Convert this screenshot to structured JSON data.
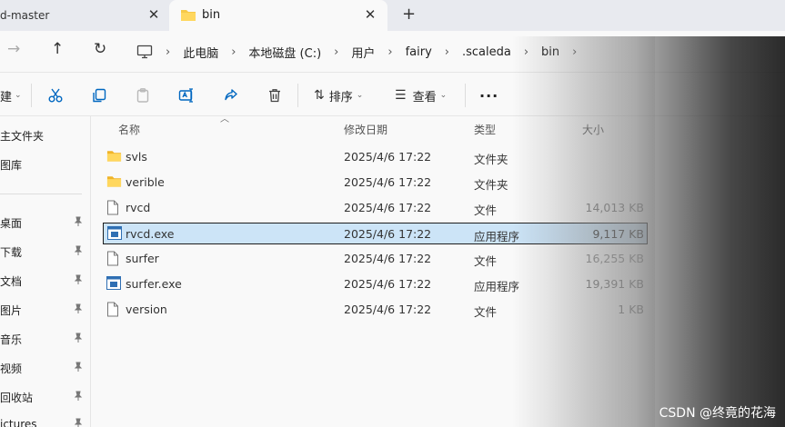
{
  "tabs": {
    "prev_title": "d-master",
    "active_title": "bin"
  },
  "breadcrumb": [
    "此电脑",
    "本地磁盘 (C:)",
    "用户",
    "fairy",
    ".scaleda",
    "bin"
  ],
  "toolbar": {
    "new_label": "建",
    "sort_label": "排序",
    "view_label": "查看"
  },
  "sidebar": {
    "top_items": [
      "主文件夹",
      "图库"
    ],
    "pinned_items": [
      "桌面",
      "下载",
      "文档",
      "图片",
      "音乐",
      "视频",
      "回收站",
      "ictures"
    ]
  },
  "columns": {
    "name": "名称",
    "modified": "修改日期",
    "type": "类型",
    "size": "大小"
  },
  "files": [
    {
      "name": "svls",
      "date": "2025/4/6 17:22",
      "type": "文件夹",
      "size": "",
      "kind": "folder"
    },
    {
      "name": "verible",
      "date": "2025/4/6 17:22",
      "type": "文件夹",
      "size": "",
      "kind": "folder"
    },
    {
      "name": "rvcd",
      "date": "2025/4/6 17:22",
      "type": "文件",
      "size": "14,013 KB",
      "kind": "file"
    },
    {
      "name": "rvcd.exe",
      "date": "2025/4/6 17:22",
      "type": "应用程序",
      "size": "9,117 KB",
      "kind": "exe",
      "selected": true
    },
    {
      "name": "surfer",
      "date": "2025/4/6 17:22",
      "type": "文件",
      "size": "16,255 KB",
      "kind": "file"
    },
    {
      "name": "surfer.exe",
      "date": "2025/4/6 17:22",
      "type": "应用程序",
      "size": "19,391 KB",
      "kind": "exe"
    },
    {
      "name": "version",
      "date": "2025/4/6 17:22",
      "type": "文件",
      "size": "1 KB",
      "kind": "file"
    }
  ],
  "watermark": "CSDN @终竟的花海",
  "colors": {
    "selection": "#cce4f7",
    "folder": "#f7c948",
    "accent": "#0067c0"
  }
}
